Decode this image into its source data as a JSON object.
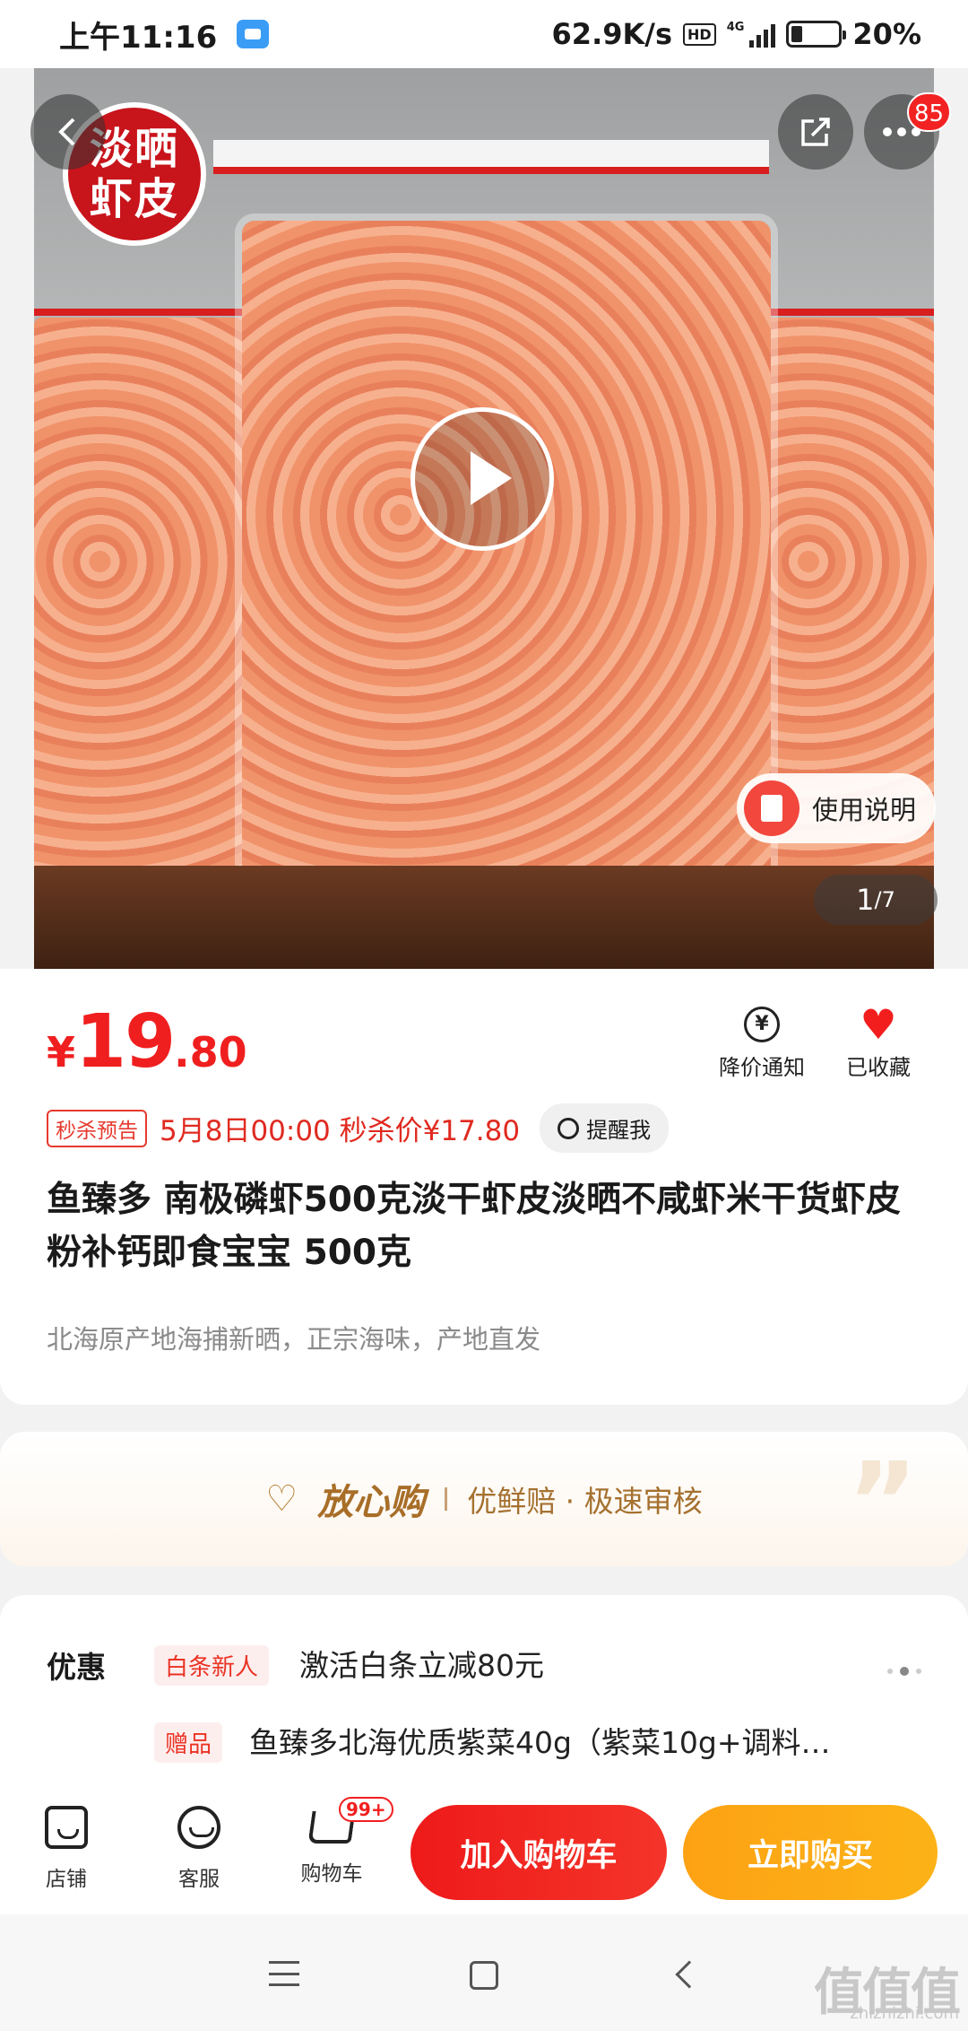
{
  "status_bar": {
    "time": "上午11:16",
    "net_speed": "62.9K/s",
    "hd": "HD",
    "network": "4G",
    "battery": "20%"
  },
  "hero": {
    "stamp_line1": "淡晒",
    "stamp_line2": "虾皮",
    "cart_count_badge": "85",
    "guide_label": "使用说明",
    "pager_current": "1",
    "pager_total": "/7"
  },
  "product": {
    "currency": "¥",
    "price_int": "19",
    "price_dec": ".80",
    "notify_label": "降价通知",
    "fav_label": "已收藏",
    "flash_tag": "秒杀预告",
    "flash_text": "5月8日00:00 秒杀价¥17.80",
    "remind_label": "提醒我",
    "title": "鱼臻多 南极磷虾500克淡干虾皮淡晒不咸虾米干货虾皮粉补钙即食宝宝 500克",
    "subtitle": "北海原产地海捕新晒，正宗海味，产地直发"
  },
  "assurance": {
    "brand": "放心购",
    "desc": "优鲜赔 · 极速审核"
  },
  "coupons": {
    "label": "优惠",
    "items": [
      {
        "tag": "白条新人",
        "text": "激活白条立减80元"
      },
      {
        "tag": "赠品",
        "text": "鱼臻多北海优质紫菜40g（紫菜10g+调料…"
      }
    ]
  },
  "bottom_bar": {
    "shop": "店铺",
    "service": "客服",
    "cart": "购物车",
    "cart_badge": "99+",
    "add_to_cart": "加入购物车",
    "buy_now": "立即购买"
  },
  "watermark": {
    "main": "值值值",
    "sub": "zhizhizhi.com"
  }
}
